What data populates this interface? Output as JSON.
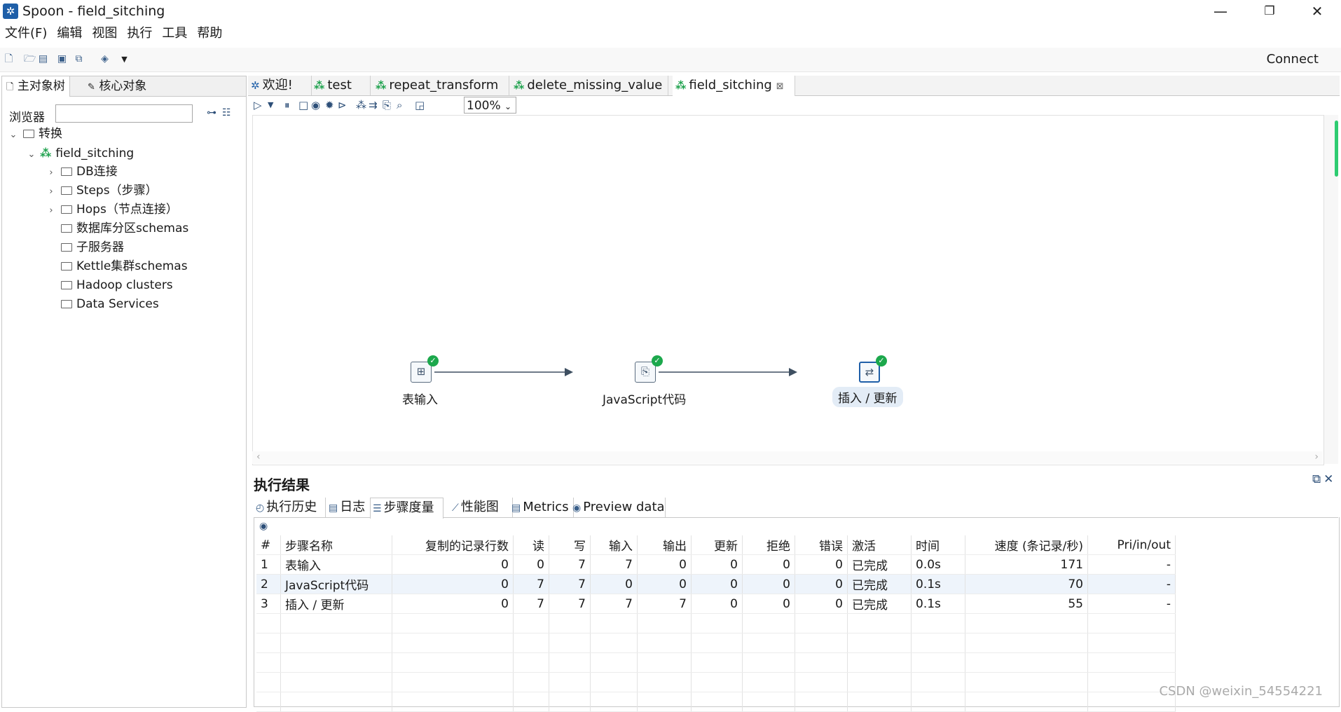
{
  "window": {
    "app_icon": "spoon-icon",
    "title": "Spoon - field_sitching",
    "minimize": "—",
    "maximize": "❐",
    "close": "✕"
  },
  "menu": [
    "文件(F)",
    "编辑",
    "视图",
    "执行",
    "工具",
    "帮助"
  ],
  "toolbar": {
    "icons": [
      "new-file-icon",
      "open-icon",
      "explore-icon",
      "save-icon",
      "save-as-icon",
      "layers-icon",
      "dropdown-arrow-icon"
    ],
    "connect": "Connect"
  },
  "left_panel": {
    "tabs": [
      "主对象树",
      "核心对象"
    ],
    "browser_label": "浏览器",
    "search_value": "",
    "tree": [
      {
        "label": "转换",
        "level": 0,
        "expanded": true,
        "icon": "folder-icon"
      },
      {
        "label": "field_sitching",
        "level": 1,
        "expanded": true,
        "icon": "transformation-icon"
      },
      {
        "label": "DB连接",
        "level": 2,
        "expandable": true,
        "icon": "folder-icon"
      },
      {
        "label": "Steps（步骤）",
        "level": 2,
        "expandable": true,
        "icon": "folder-icon"
      },
      {
        "label": "Hops（节点连接）",
        "level": 2,
        "expandable": true,
        "icon": "folder-icon"
      },
      {
        "label": "数据库分区schemas",
        "level": 2,
        "icon": "folder-icon"
      },
      {
        "label": "子服务器",
        "level": 2,
        "icon": "folder-icon"
      },
      {
        "label": "Kettle集群schemas",
        "level": 2,
        "icon": "folder-icon"
      },
      {
        "label": "Hadoop clusters",
        "level": 2,
        "icon": "folder-icon"
      },
      {
        "label": "Data Services",
        "level": 2,
        "icon": "folder-icon"
      }
    ]
  },
  "editor_tabs": [
    {
      "label": "欢迎!",
      "icon": "welcome-icon"
    },
    {
      "label": "test",
      "icon": "transformation-icon"
    },
    {
      "label": "repeat_transform",
      "icon": "transformation-icon"
    },
    {
      "label": "delete_missing_value",
      "icon": "transformation-icon"
    },
    {
      "label": "field_sitching",
      "icon": "transformation-icon",
      "active": true
    }
  ],
  "canvas_toolbar": {
    "zoom": "100%"
  },
  "canvas": {
    "steps": [
      {
        "label": "表输入",
        "icon": "table-input-icon",
        "status": "ok"
      },
      {
        "label": "JavaScript代码",
        "icon": "javascript-icon",
        "status": "ok"
      },
      {
        "label": "插入 / 更新",
        "icon": "insert-update-icon",
        "status": "ok",
        "selected": true
      }
    ]
  },
  "results": {
    "title": "执行结果",
    "tabs": [
      {
        "label": "执行历史",
        "icon": "history-icon"
      },
      {
        "label": "日志",
        "icon": "log-icon"
      },
      {
        "label": "步骤度量",
        "icon": "metrics-list-icon",
        "active": true
      },
      {
        "label": "性能图",
        "icon": "chart-icon"
      },
      {
        "label": "Metrics",
        "icon": "metrics-icon"
      },
      {
        "label": "Preview data",
        "icon": "preview-icon"
      }
    ],
    "columns": [
      "#",
      "步骤名称",
      "复制的记录行数",
      "读",
      "写",
      "输入",
      "输出",
      "更新",
      "拒绝",
      "错误",
      "激活",
      "时间",
      "速度 (条记录/秒)",
      "Pri/in/out"
    ],
    "rows": [
      [
        "1",
        "表输入",
        "0",
        "0",
        "7",
        "7",
        "0",
        "0",
        "0",
        "0",
        "已完成",
        "0.0s",
        "171",
        "-"
      ],
      [
        "2",
        "JavaScript代码",
        "0",
        "7",
        "7",
        "0",
        "0",
        "0",
        "0",
        "0",
        "已完成",
        "0.1s",
        "70",
        "-"
      ],
      [
        "3",
        "插入 / 更新",
        "0",
        "7",
        "7",
        "7",
        "7",
        "0",
        "0",
        "0",
        "已完成",
        "0.1s",
        "55",
        "-"
      ]
    ]
  },
  "watermark": "CSDN @weixin_54554221"
}
